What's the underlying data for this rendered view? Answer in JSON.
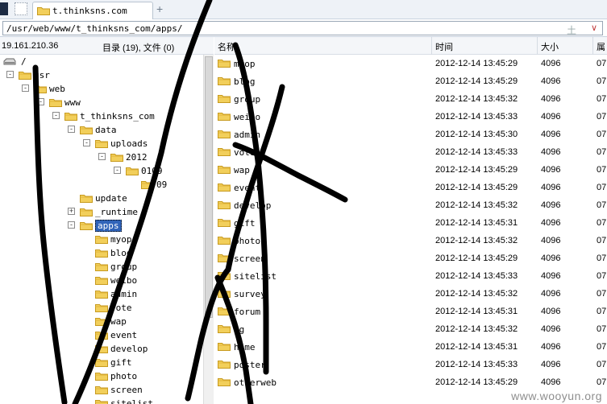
{
  "tabs": {
    "active_label": "t.thinksns.com",
    "new_tab_glyph": "+"
  },
  "address": {
    "path": "/usr/web/www/t_thinksns_com/apps/",
    "extra_glyph": "土",
    "dropdown_glyph": "∨"
  },
  "left": {
    "ip": "19.161.210.36",
    "dir_count": "目录 (19), 文件 (0)",
    "tree": [
      {
        "label": "/",
        "level": 0,
        "kind": "drive",
        "expander": ""
      },
      {
        "label": "usr",
        "level": 0,
        "kind": "folder",
        "expander": "-"
      },
      {
        "label": "web",
        "level": 1,
        "kind": "folder",
        "expander": "-"
      },
      {
        "label": "www",
        "level": 2,
        "kind": "folder",
        "expander": "-"
      },
      {
        "label": "t_thinksns_com",
        "level": 3,
        "kind": "folder",
        "expander": "-"
      },
      {
        "label": "data",
        "level": 4,
        "kind": "folder",
        "expander": "-"
      },
      {
        "label": "uploads",
        "level": 5,
        "kind": "folder",
        "expander": "-"
      },
      {
        "label": "2012",
        "level": 6,
        "kind": "folder",
        "expander": "-"
      },
      {
        "label": "0109",
        "level": 7,
        "kind": "folder",
        "expander": "-"
      },
      {
        "label": "09",
        "level": 8,
        "kind": "folder",
        "expander": ""
      },
      {
        "label": "update",
        "level": 4,
        "kind": "folder",
        "expander": ""
      },
      {
        "label": "_runtime",
        "level": 4,
        "kind": "folder",
        "expander": "+"
      },
      {
        "label": "apps",
        "level": 4,
        "kind": "folder",
        "expander": "-",
        "selected": true
      },
      {
        "label": "myop",
        "level": 5,
        "kind": "folder",
        "expander": ""
      },
      {
        "label": "blog",
        "level": 5,
        "kind": "folder",
        "expander": ""
      },
      {
        "label": "group",
        "level": 5,
        "kind": "folder",
        "expander": ""
      },
      {
        "label": "weibo",
        "level": 5,
        "kind": "folder",
        "expander": ""
      },
      {
        "label": "admin",
        "level": 5,
        "kind": "folder",
        "expander": ""
      },
      {
        "label": "vote",
        "level": 5,
        "kind": "folder",
        "expander": ""
      },
      {
        "label": "wap",
        "level": 5,
        "kind": "folder",
        "expander": ""
      },
      {
        "label": "event",
        "level": 5,
        "kind": "folder",
        "expander": ""
      },
      {
        "label": "develop",
        "level": 5,
        "kind": "folder",
        "expander": ""
      },
      {
        "label": "gift",
        "level": 5,
        "kind": "folder",
        "expander": ""
      },
      {
        "label": "photo",
        "level": 5,
        "kind": "folder",
        "expander": ""
      },
      {
        "label": "screen",
        "level": 5,
        "kind": "folder",
        "expander": ""
      },
      {
        "label": "sitelist",
        "level": 5,
        "kind": "folder",
        "expander": ""
      }
    ]
  },
  "columns": {
    "name": "名称",
    "time": "时间",
    "size": "大小",
    "attr": "属"
  },
  "files": [
    {
      "name": "myop",
      "time": "2012-12-14 13:45:29",
      "size": "4096",
      "attr": "07"
    },
    {
      "name": "blog",
      "time": "2012-12-14 13:45:29",
      "size": "4096",
      "attr": "07"
    },
    {
      "name": "group",
      "time": "2012-12-14 13:45:32",
      "size": "4096",
      "attr": "07"
    },
    {
      "name": "weibo",
      "time": "2012-12-14 13:45:33",
      "size": "4096",
      "attr": "07"
    },
    {
      "name": "admin",
      "time": "2012-12-14 13:45:30",
      "size": "4096",
      "attr": "07"
    },
    {
      "name": "vote",
      "time": "2012-12-14 13:45:33",
      "size": "4096",
      "attr": "07"
    },
    {
      "name": "wap",
      "time": "2012-12-14 13:45:29",
      "size": "4096",
      "attr": "07"
    },
    {
      "name": "event",
      "time": "2012-12-14 13:45:29",
      "size": "4096",
      "attr": "07"
    },
    {
      "name": "develop",
      "time": "2012-12-14 13:45:32",
      "size": "4096",
      "attr": "07"
    },
    {
      "name": "gift",
      "time": "2012-12-14 13:45:31",
      "size": "4096",
      "attr": "07"
    },
    {
      "name": "photo",
      "time": "2012-12-14 13:45:32",
      "size": "4096",
      "attr": "07"
    },
    {
      "name": "screen",
      "time": "2012-12-14 13:45:29",
      "size": "4096",
      "attr": "07"
    },
    {
      "name": "sitelist",
      "time": "2012-12-14 13:45:33",
      "size": "4096",
      "attr": "07"
    },
    {
      "name": "survey",
      "time": "2012-12-14 13:45:32",
      "size": "4096",
      "attr": "07"
    },
    {
      "name": "forum",
      "time": "2012-12-14 13:45:31",
      "size": "4096",
      "attr": "07"
    },
    {
      "name": "3g",
      "time": "2012-12-14 13:45:32",
      "size": "4096",
      "attr": "07"
    },
    {
      "name": "home",
      "time": "2012-12-14 13:45:31",
      "size": "4096",
      "attr": "07"
    },
    {
      "name": "poster",
      "time": "2012-12-14 13:45:33",
      "size": "4096",
      "attr": "07"
    },
    {
      "name": "otherweb",
      "time": "2012-12-14 13:45:29",
      "size": "4096",
      "attr": "07"
    }
  ],
  "watermark": "www.wooyun.org",
  "icons": [
    "window-icon",
    "page-icon",
    "folder-icon",
    "drive-icon",
    "plus-icon",
    "dropdown-icon"
  ],
  "colors": {
    "folder": "#f2cf5b",
    "folder_edge": "#c79a1e",
    "selection": "#3164b9",
    "scribble": "#000000"
  }
}
